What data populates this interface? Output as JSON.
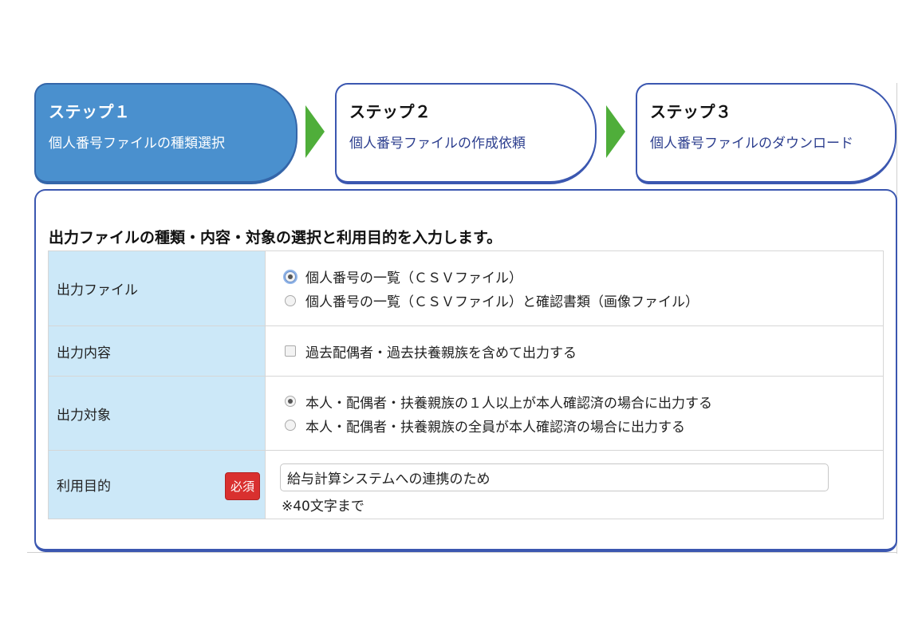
{
  "steps": [
    {
      "title": "ステップ１",
      "subtitle": "個人番号ファイルの種類選択"
    },
    {
      "title": "ステップ２",
      "subtitle": "個人番号ファイルの作成依頼"
    },
    {
      "title": "ステップ３",
      "subtitle": "個人番号ファイルのダウンロード"
    }
  ],
  "colors": {
    "active_step": "#4a90ce",
    "step_border": "#3b57b0",
    "arrow": "#4fae3a",
    "label_bg": "#cce8f8",
    "required_badge": "#d9302f"
  },
  "panel": {
    "heading": "出力ファイルの種類・内容・対象の選択と利用目的を入力します。",
    "rows": {
      "output_file": {
        "label": "出力ファイル",
        "options": [
          "個人番号の一覧（ＣＳＶファイル）",
          "個人番号の一覧（ＣＳＶファイル）と確認書類（画像ファイル）"
        ],
        "selected": 0
      },
      "output_content": {
        "label": "出力内容",
        "checkbox_label": "過去配偶者・過去扶養親族を含めて出力する",
        "checked": false
      },
      "output_target": {
        "label": "出力対象",
        "options": [
          "本人・配偶者・扶養親族の１人以上が本人確認済の場合に出力する",
          "本人・配偶者・扶養親族の全員が本人確認済の場合に出力する"
        ],
        "selected": 0
      },
      "purpose": {
        "label": "利用目的",
        "required_badge": "必須",
        "value": "給与計算システムへの連携のため",
        "hint": "※40文字まで"
      }
    }
  }
}
